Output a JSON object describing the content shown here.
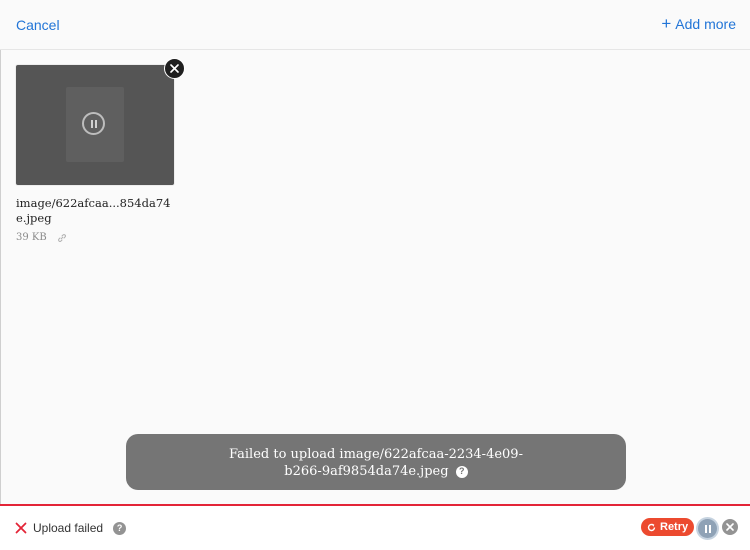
{
  "header": {
    "cancel_label": "Cancel",
    "add_more_label": "Add more",
    "add_more_icon": "plus-icon"
  },
  "files": [
    {
      "name": "image/622afcaa...854da74e.jpeg",
      "size": "39 KB",
      "state": "paused",
      "icons": [
        "pause-icon",
        "remove-icon",
        "link-icon"
      ]
    }
  ],
  "toast": {
    "line1": "Failed to upload image/622afcaa-2234-4e09-",
    "line2": "b266-9af9854da74e.jpeg",
    "help_glyph": "?"
  },
  "status_bar": {
    "status_text": "Upload failed",
    "help_glyph": "?",
    "retry_label": "Retry",
    "colors": {
      "error": "#e32437",
      "retry": "#ec4a2f",
      "accent": "#2275d7"
    }
  }
}
